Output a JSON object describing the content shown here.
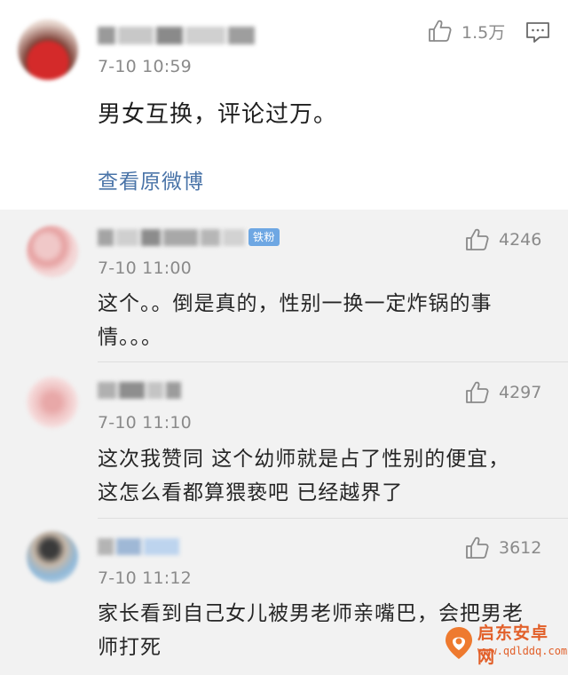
{
  "main_post": {
    "timestamp": "7-10 10:59",
    "like_count": "1.5万",
    "text": "男女互换，评论过万。",
    "view_original": "查看原微博"
  },
  "comments": [
    {
      "timestamp": "7-10 11:00",
      "like_count": "4246",
      "badge": "铁粉",
      "lines": [
        "这个。。倒是真的，性别一换一定炸锅的事",
        "情。。。"
      ]
    },
    {
      "timestamp": "7-10 11:10",
      "like_count": "4297",
      "lines": [
        "这次我赞同 这个幼师就是占了性别的便宜，",
        "这怎么看都算猥亵吧 已经越界了"
      ]
    },
    {
      "timestamp": "7-10 11:12",
      "like_count": "3612",
      "lines": [
        "家长看到自己女儿被男老师亲嘴巴，会把男老",
        "师打死"
      ]
    }
  ],
  "watermark": {
    "title": "启东安卓网",
    "url": "www.qdlddq.com"
  },
  "colors": {
    "link": "#4a74a8",
    "badge": "#6ea7e3",
    "comment_bg": "#f2f2f2",
    "watermark": "#e2602a"
  }
}
